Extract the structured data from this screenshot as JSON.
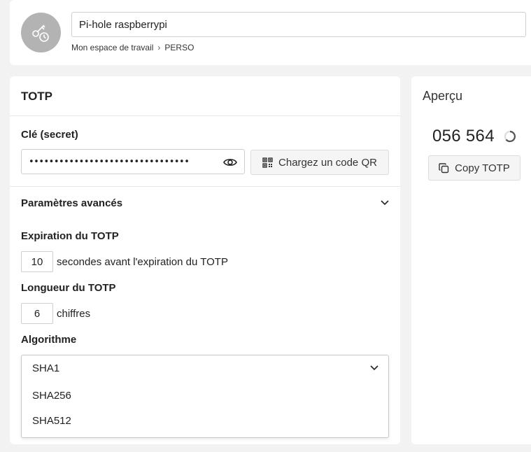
{
  "header": {
    "title_value": "Pi-hole raspberrypi",
    "breadcrumb": {
      "workspace": "Mon espace de travail",
      "separator": "›",
      "folder": "PERSO"
    },
    "avatar_icon": "key-clock-icon"
  },
  "totp": {
    "card_title": "TOTP",
    "secret": {
      "label": "Clé (secret)",
      "masked_value": "••••••••••••••••••••••••••••••••",
      "reveal_icon": "eye-icon"
    },
    "qr_button": {
      "label": "Chargez un code QR",
      "icon": "qr-code-icon"
    },
    "advanced": {
      "label": "Paramètres avancés",
      "icon": "chevron-down-icon",
      "expiration": {
        "label": "Expiration du TOTP",
        "value": "10",
        "suffix": "secondes avant l'expiration du TOTP"
      },
      "length": {
        "label": "Longueur du TOTP",
        "value": "6",
        "suffix": "chiffres"
      },
      "algorithm": {
        "label": "Algorithme",
        "selected": "SHA1",
        "options": [
          "SHA256",
          "SHA512"
        ]
      }
    }
  },
  "preview": {
    "title": "Aperçu",
    "code": "056 564",
    "copy_button": "Copy TOTP",
    "copy_icon": "copy-icon",
    "spinner_icon": "loading-spinner-icon"
  },
  "colors": {
    "background": "#f2f2f2",
    "card": "#ffffff",
    "avatar": "#b3b3b3",
    "border": "#cfcfcf"
  }
}
